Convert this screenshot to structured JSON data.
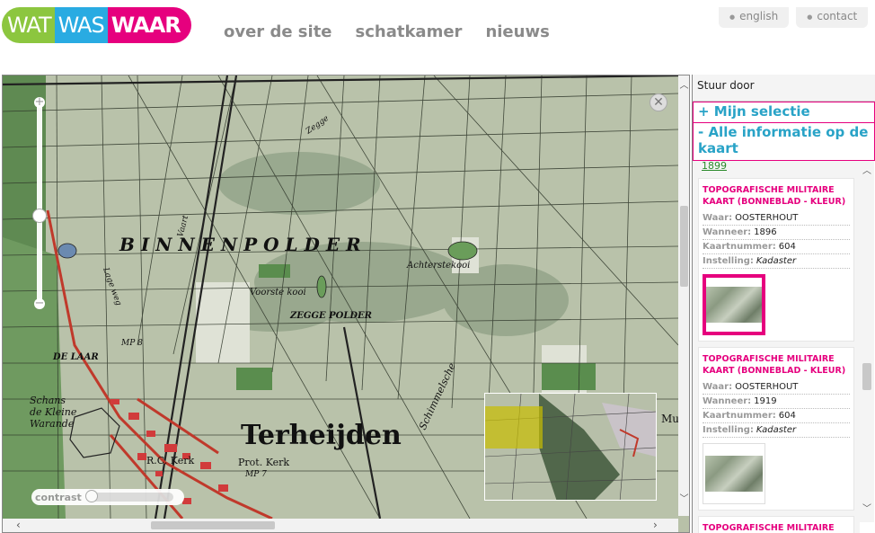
{
  "header": {
    "logo": {
      "part1": "WAT",
      "part2": "WAS",
      "part3": "WAAR"
    },
    "nav": [
      "over de site",
      "schatkamer",
      "nieuws"
    ],
    "util": [
      "english",
      "contact"
    ]
  },
  "map": {
    "labels": {
      "binnenpolder": "B I N N E N P O L D E R",
      "zegge_polder": "ZEGGE POLDER",
      "voorste_kooi": "Voorste kooi",
      "achterste_kooi": "Achterstekooi",
      "terheijden": "Terheijden",
      "schans": "Schans",
      "de_kleine": "de Kleine",
      "warande": "Warande",
      "rc_kerk": "R.C. Kerk",
      "prot_kerk": "Prot. Kerk",
      "de_laar": "DE LAAR",
      "mp8": "MP 8",
      "mp7": "MP 7",
      "schimmelsche": "Schimmelsche",
      "lage_weg": "Lage weg",
      "vaart": "Vaart",
      "zegge": "Zegge",
      "mu": "Mu"
    },
    "zoom_plus": "+",
    "zoom_minus": "−",
    "contrast_label": "contrast",
    "close_icon": "✕"
  },
  "sidebar": {
    "header": "Stuur door",
    "my_selection": "+ Mijn selectie",
    "all_info": "- Alle informatie op de kaart",
    "prev_year": "1899",
    "results": [
      {
        "title": "TOPOGRAFISCHE MILITAIRE KAART (BONNEBLAD - KLEUR)",
        "waar_label": "Waar:",
        "waar": "OOSTERHOUT",
        "wanneer_label": "Wanneer:",
        "wanneer": "1896",
        "kaart_label": "Kaartnummer:",
        "kaartnummer": "604",
        "inst_label": "Instelling:",
        "instelling": "Kadaster"
      },
      {
        "title": "TOPOGRAFISCHE MILITAIRE KAART (BONNEBLAD - KLEUR)",
        "waar_label": "Waar:",
        "waar": "OOSTERHOUT",
        "wanneer_label": "Wanneer:",
        "wanneer": "1919",
        "kaart_label": "Kaartnummer:",
        "kaartnummer": "604",
        "inst_label": "Instelling:",
        "instelling": "Kadaster"
      },
      {
        "title": "TOPOGRAFISCHE MILITAIRE KAART (BONNEBLAD - KLEUR)"
      }
    ]
  },
  "colors": {
    "brand_green": "#8cc63f",
    "brand_blue": "#29abe2",
    "brand_pink": "#e6007e",
    "link_blue": "#29a3c7",
    "map_base": "#b8c1a8"
  }
}
